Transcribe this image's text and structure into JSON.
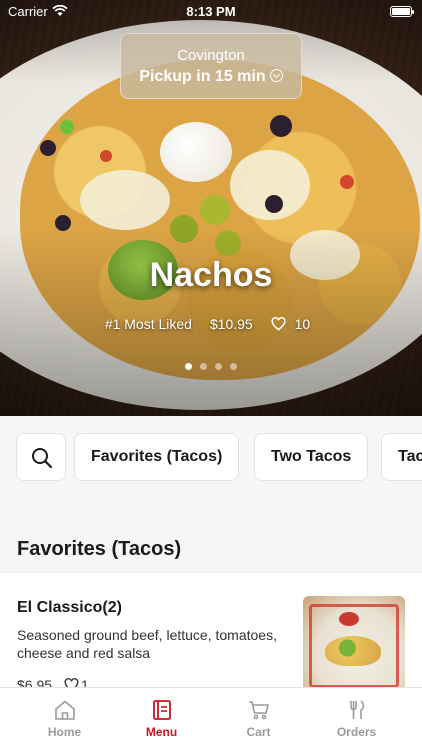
{
  "status_bar": {
    "carrier": "Carrier",
    "time": "8:13 PM"
  },
  "hero": {
    "location": {
      "city": "Covington",
      "pickup": "Pickup in 15 min"
    },
    "title": "Nachos",
    "rank": "#1 Most Liked",
    "price": "$10.95",
    "likes": "10",
    "pager": {
      "count": 4,
      "active_index": 0
    }
  },
  "categories": {
    "search_icon": "search-icon",
    "chips": [
      "Favorites (Tacos)",
      "Two Tacos",
      "Tacos"
    ]
  },
  "section": {
    "title": "Favorites (Tacos)",
    "items": [
      {
        "name": "El Classico(2)",
        "description": "Seasoned ground beef, lettuce, tomatoes, cheese and red salsa",
        "price": "$6.95",
        "likes": "1"
      }
    ]
  },
  "tab_bar": {
    "accent": "#c8161f",
    "inactive": "#9a9a9e",
    "tabs": [
      {
        "label": "Home",
        "icon": "home-icon"
      },
      {
        "label": "Menu",
        "icon": "menu-icon",
        "active": true
      },
      {
        "label": "Cart",
        "icon": "cart-icon"
      },
      {
        "label": "Orders",
        "icon": "utensils-icon"
      }
    ]
  }
}
